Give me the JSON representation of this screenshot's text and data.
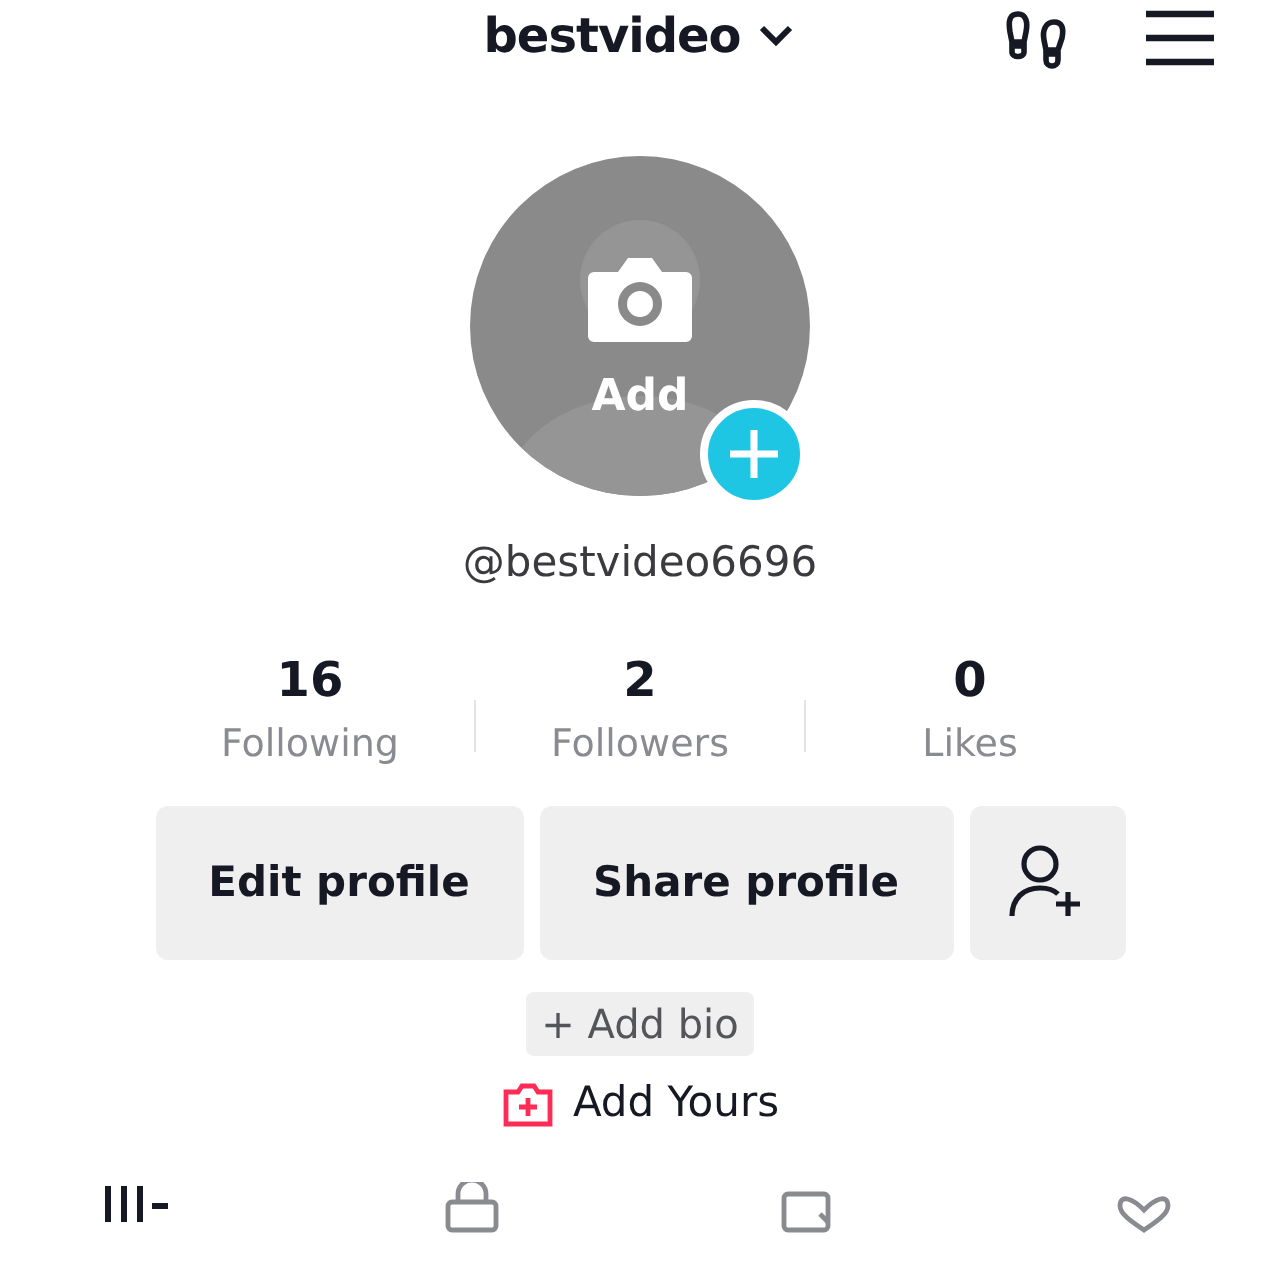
{
  "header": {
    "username": "bestvideo"
  },
  "avatar": {
    "label": "Add"
  },
  "handle": "@bestvideo6696",
  "stats": [
    {
      "value": "16",
      "label": "Following"
    },
    {
      "value": "2",
      "label": "Followers"
    },
    {
      "value": "0",
      "label": "Likes"
    }
  ],
  "buttons": [
    "Edit profile",
    "Share profile"
  ],
  "add_bio": "+ Add bio",
  "add_yours": "Add Yours",
  "tabs": [
    {
      "kind": "videos",
      "selected": true
    },
    {
      "kind": "private",
      "selected": false
    },
    {
      "kind": "reposts",
      "selected": false
    },
    {
      "kind": "liked",
      "selected": false
    }
  ]
}
